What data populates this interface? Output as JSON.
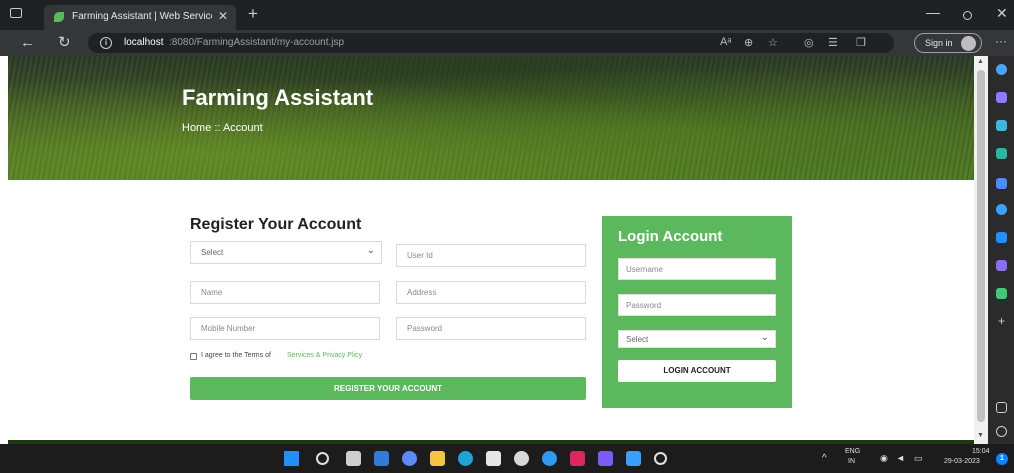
{
  "browser": {
    "tab_title": "Farming Assistant | Web Service",
    "tab_close": "✕",
    "new_tab": "+",
    "url_host": "localhost",
    "url_path": ":8080/FarmingAssistant/my-account.jsp",
    "sign_in_label": "Sign in",
    "back_glyph": "←",
    "reload_glyph": "↻",
    "more_glyph": "···",
    "minimize_glyph": "—",
    "close_glyph": "✕"
  },
  "hero": {
    "title": "Farming Assistant",
    "breadcrumb": "Home  ::  Account"
  },
  "register": {
    "title": "Register Your Account",
    "role_select": "Select",
    "user_id_placeholder": "User Id",
    "name_placeholder": "Name",
    "address_placeholder": "Address",
    "mobile_placeholder": "Mobile Number",
    "password_placeholder": "Password",
    "terms_text": "I agree to the Terms of",
    "terms_link": "Services & Privacy Plicy",
    "submit_label": "REGISTER YOUR ACCOUNT"
  },
  "login": {
    "title": "Login Account",
    "username_placeholder": "Username",
    "password_placeholder": "Password",
    "role_select": "Select",
    "submit_label": "LOGIN ACCOUNT"
  },
  "taskbar": {
    "language": "ENG",
    "region": "IN",
    "time": "15:04",
    "date": "29-03-2023",
    "notification_count": "1"
  },
  "colors": {
    "accent_green": "#5cb85c",
    "browser_dark": "#202124",
    "tab_active": "#35363a"
  }
}
